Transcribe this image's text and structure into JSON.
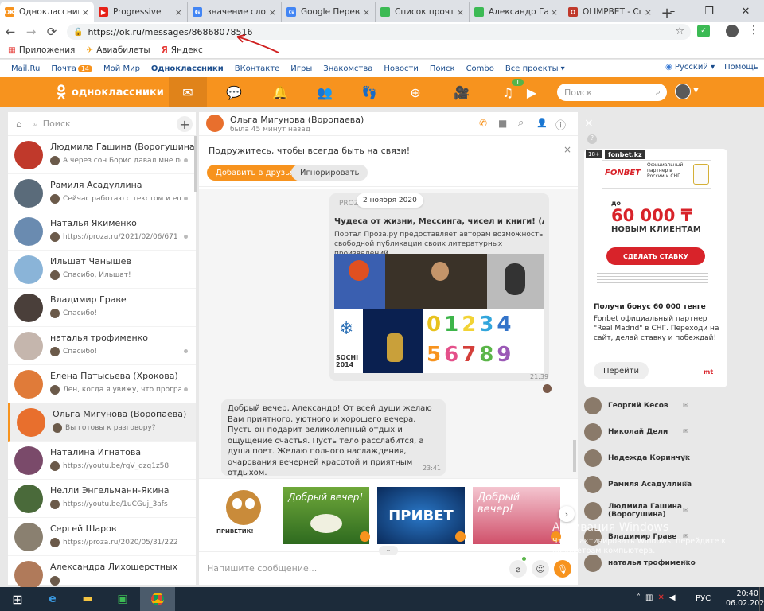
{
  "browser": {
    "tabs": [
      {
        "title": "Одноклассники",
        "fav": "OK",
        "color": "#f7931e",
        "active": true
      },
      {
        "title": "Progressive",
        "fav": "▶",
        "color": "#e62117",
        "active": false
      },
      {
        "title": "значение слова",
        "fav": "G",
        "color": "#4285f4",
        "active": false
      },
      {
        "title": "Google Перевод",
        "fav": "G",
        "color": "#4285f4",
        "active": false
      },
      {
        "title": "Список прочтен",
        "fav": "",
        "color": "#3cba54",
        "active": false
      },
      {
        "title": "Александр Гашн",
        "fav": "",
        "color": "#3cba54",
        "active": false
      },
      {
        "title": "OLIMPBET - Спи",
        "fav": "O",
        "color": "#c0392b",
        "active": false
      }
    ],
    "url": "https://ok.ru/messages/86868078516",
    "bookmarks": [
      "Приложения",
      "Авиабилеты",
      "Яндекс"
    ]
  },
  "toplinks": [
    "Mail.Ru",
    "Почта",
    "Мой Мир",
    "Одноклассники",
    "ВКонтакте",
    "Игры",
    "Знакомства",
    "Новости",
    "Поиск",
    "Combo",
    "Все проекты ▾"
  ],
  "mail_badge": "14",
  "toplinks_right": [
    "Русский ▾",
    "Помощь"
  ],
  "ok": {
    "logo": "одноклассники",
    "search_placeholder": "Поиск",
    "music_badge": "1"
  },
  "chat_list": {
    "search_placeholder": "Поиск",
    "items": [
      {
        "name": "Людмила Гашина (Ворогушина)",
        "msg": "А через сон Борис давал мне по...",
        "dot": true,
        "av": "#c0392b",
        "sel": false
      },
      {
        "name": "Рамиля Асадуллина",
        "msg": "Сейчас работаю с текстом и ещ...",
        "dot": true,
        "av": "#5a6b7a",
        "sel": false
      },
      {
        "name": "Наталья Якименко",
        "msg": "https://proza.ru/2021/02/06/671",
        "dot": true,
        "av": "#6a8bb0",
        "sel": false
      },
      {
        "name": "Ильшат Чанышев",
        "msg": "Спасибо, Ильшат!",
        "dot": false,
        "av": "#8ab4d8",
        "sel": false
      },
      {
        "name": "Владимир Граве",
        "msg": "Спасибо!",
        "dot": false,
        "av": "#4a3f3a",
        "sel": false
      },
      {
        "name": "наталья трофименко",
        "msg": "Спасибо!",
        "dot": true,
        "av": "#c5b6ad",
        "sel": false
      },
      {
        "name": "Елена Патысьева (Хрокова)",
        "msg": "Лен, когда я увижу, что програм...",
        "dot": true,
        "av": "#e07b39",
        "sel": false
      },
      {
        "name": "Ольга Мигунова (Воропаева)",
        "msg": "Вы готовы к разговору?",
        "dot": false,
        "av": "#e86f2d",
        "sel": true
      },
      {
        "name": "Наталина Игнатова",
        "msg": "https://youtu.be/rgV_dzg1z58",
        "dot": false,
        "av": "#7a4a6a",
        "sel": false
      },
      {
        "name": "Нелли Энгельманн-Якина",
        "msg": "https://youtu.be/1uCGuj_3afs",
        "dot": false,
        "av": "#4a6a3a",
        "sel": false
      },
      {
        "name": "Сергей Шаров",
        "msg": "https://proza.ru/2020/05/31/222",
        "dot": false,
        "av": "#8a8070",
        "sel": false
      },
      {
        "name": "Александра Лихошерстных",
        "msg": "",
        "dot": false,
        "av": "#b07a5a",
        "sel": false
      }
    ]
  },
  "conversation": {
    "name": "Ольга Мигунова (Воропаева)",
    "status": "была 45 минут назад",
    "invite_text": "Подружитесь, чтобы всегда быть на связи!",
    "add_friend": "Добавить в друзья",
    "ignore": "Игнорировать",
    "date_chip": "2 ноября 2020",
    "link_card": {
      "site": "PROZ",
      "title": "Чудеса от жизни, Мессинга, чисел и книги! (Ал...",
      "desc": "Портал Проза.ру предоставляет авторам возможность свободной публикации своих литературных произведений...",
      "time": "21:39",
      "sochi": "SOCHI 2014"
    },
    "incoming": {
      "text": "Добрый вечер, Александр! От всей души желаю Вам приятного, уютного и хорошего вечера. Пусть он подарит великолепный отдых и ощущение счастья. Пусть тело расслабится, а душа поет. Желаю полного наслаждения, очарования вечерней красотой и приятным отдыхом.",
      "time": "23:41"
    },
    "stickers": [
      "Добрый вечер!",
      "ПРИВЕТ",
      "Добрый вечер!"
    ],
    "sticker_cat": "ПРИВЕТИК!",
    "composer_placeholder": "Напишите сообщение..."
  },
  "ad": {
    "age": "18+",
    "site": "fonbet.kz",
    "brand": "FONBET",
    "partner": "Официальный партнер в России и СНГ",
    "up_to": "до",
    "amount": "60 000 ₸",
    "new_clients": "НОВЫМ КЛИЕНТАМ",
    "cta": "СДЕЛАТЬ СТАВКУ",
    "headline": "Получи бонус 60 000 тенге",
    "body": "Fonbet официальный партнер \"Real Madrid\" в СНГ. Переходи на сайт, делай ставку и побеждай!",
    "go": "Перейти"
  },
  "right_list": [
    "Георгий Кесов",
    "Николай Дели",
    "Надежда Коринчук",
    "Рамиля Асадуллина",
    "Людмила Гашина (Ворогушина)",
    "Владимир Граве",
    "наталья трофименко"
  ],
  "watermark": {
    "title": "Активация Windows",
    "text": "Чтобы активировать Windows, перейдите к параметрам компьютера."
  },
  "taskbar": {
    "lang": "РУС",
    "time": "20:40",
    "date": "06.02.2021"
  }
}
